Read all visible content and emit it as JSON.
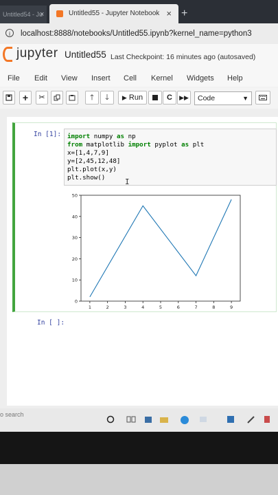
{
  "browser": {
    "prev_tab_title": "Untitled54 - Ju",
    "active_tab_title": "Untitled55 - Jupyter Notebook",
    "close_glyph": "×",
    "new_tab_glyph": "+",
    "url": "localhost:8888/notebooks/Untitled55.ipynb?kernel_name=python3"
  },
  "jupyter": {
    "logo_text": "jupyter",
    "notebook_name": "Untitled55",
    "checkpoint": "Last Checkpoint: 16 minutes ago  (autosaved)"
  },
  "menu": [
    "File",
    "Edit",
    "View",
    "Insert",
    "Cell",
    "Kernel",
    "Widgets",
    "Help"
  ],
  "toolbar": {
    "run_label": "Run",
    "cell_type": "Code",
    "icons": [
      "save-icon",
      "plus-icon",
      "cut-icon",
      "copy-icon",
      "paste-icon",
      "up-arrow-icon",
      "down-arrow-icon",
      "run-icon",
      "stop-icon",
      "restart-icon",
      "fast-forward-icon",
      "keyboard-icon"
    ]
  },
  "cells": [
    {
      "prompt": "In [1]:",
      "code": [
        "import numpy as np",
        "from matplotlib import pyplot as plt",
        "x=[1,4,7,9]",
        "y=[2,45,12,48]",
        "plt.plot(x,y)",
        "plt.show()"
      ]
    },
    {
      "prompt": "In [ ]:"
    }
  ],
  "chart_data": {
    "type": "line",
    "x": [
      1,
      4,
      7,
      9
    ],
    "y": [
      2,
      45,
      12,
      48
    ],
    "xticks": [
      "1",
      "2",
      "3",
      "4",
      "5",
      "6",
      "7",
      "8",
      "9"
    ],
    "yticks": [
      "0",
      "10",
      "20",
      "30",
      "40",
      "50"
    ],
    "xlim": [
      0.5,
      9.5
    ],
    "ylim": [
      0,
      50
    ],
    "line_color": "#1f77b4",
    "title": "",
    "xlabel": "",
    "ylabel": ""
  },
  "taskbar": {
    "search_text": "o search"
  },
  "colors": {
    "accent_green": "#42a53e",
    "jupyter_orange": "#f37726",
    "prompt_blue": "#303f9f"
  }
}
